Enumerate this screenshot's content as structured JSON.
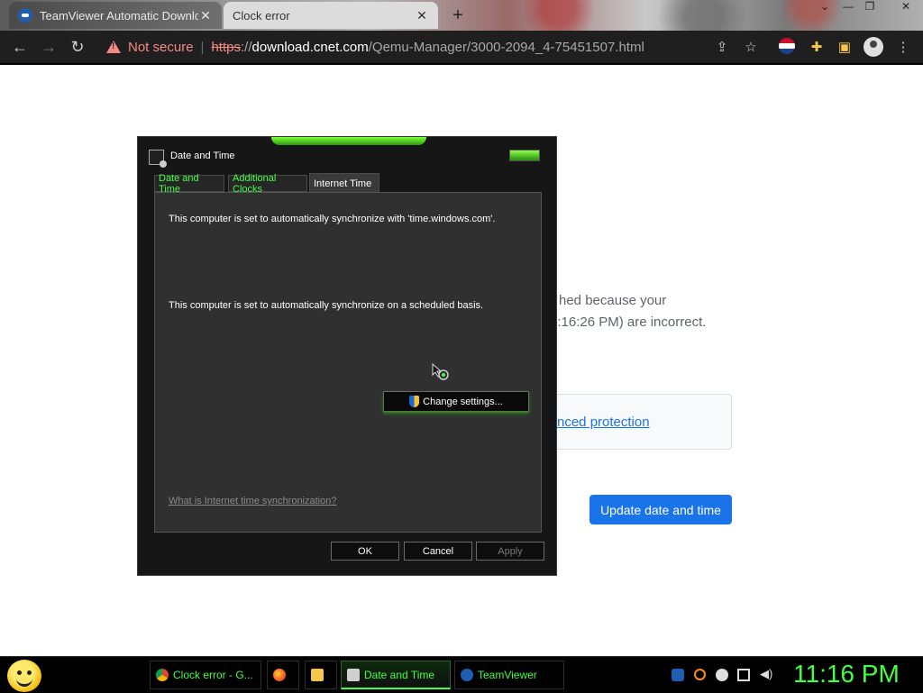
{
  "browser": {
    "tabs": [
      {
        "title": "TeamViewer Automatic Downloa",
        "active": false
      },
      {
        "title": "Clock error",
        "active": true
      }
    ],
    "new_tab": "+",
    "window_controls": {
      "minimize": "—",
      "maximize": "❐",
      "close": "✕"
    },
    "security_label": "Not secure",
    "url": {
      "scheme": "https",
      "sep": "://",
      "host": "download.cnet.com",
      "path": "/Qemu-Manager/3000-2094_4-75451507.html"
    },
    "icons": [
      "back-icon",
      "forward-icon",
      "reload-icon",
      "share-icon",
      "star-icon",
      "extensions-icon",
      "sidebar-icon",
      "profile-icon",
      "menu-icon"
    ]
  },
  "page": {
    "line1": "hed because your",
    "line2": "1:16:26 PM) are incorrect.",
    "protect_link": "nced protection",
    "update_button": "Update date and time"
  },
  "dialog": {
    "title": "Date and Time",
    "tabs": [
      "Date and Time",
      "Additional Clocks",
      "Internet Time"
    ],
    "active_tab": "Internet Time",
    "sync_text_1": "This computer is set to automatically synchronize with 'time.windows.com'.",
    "sync_text_2": "This computer is set to automatically synchronize on a scheduled basis.",
    "change_settings": "Change settings...",
    "help_link": "What is Internet time synchronization?",
    "ok": "OK",
    "cancel": "Cancel",
    "apply": "Apply",
    "accent": "#41ff41"
  },
  "taskbar": {
    "items": [
      {
        "label": "Clock error - G...",
        "icon": "chrome-icon"
      },
      {
        "label": "",
        "icon": "firefox-icon"
      },
      {
        "label": "",
        "icon": "folder-icon"
      },
      {
        "label": "Date and Time",
        "icon": "datetime-icon",
        "active": true
      },
      {
        "label": "TeamViewer",
        "icon": "teamviewer-icon"
      }
    ],
    "clock": "11:16 PM"
  }
}
